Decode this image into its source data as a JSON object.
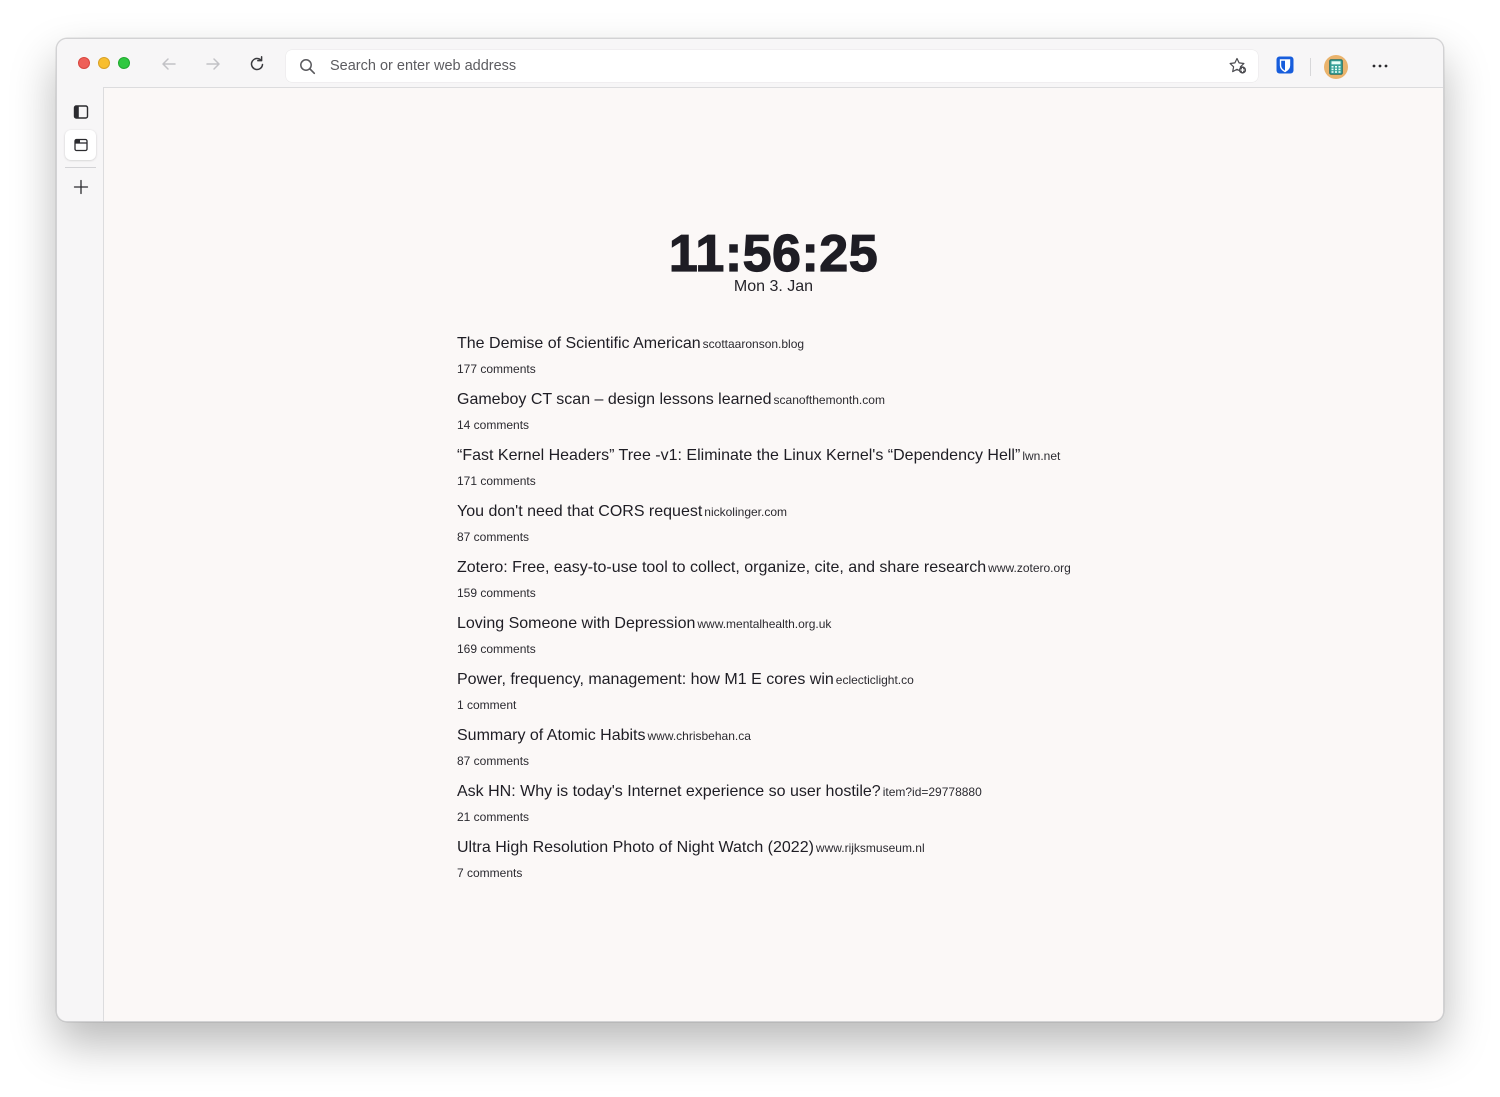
{
  "browser": {
    "address_placeholder": "Search or enter web address",
    "icons": {
      "back": "arrow-left-icon",
      "forward": "arrow-right-icon",
      "reload": "reload-icon",
      "search": "search-icon",
      "favorite": "add-favorite-icon",
      "bitwarden": "bitwarden-icon",
      "calculator": "calculator-icon",
      "menu": "more-horizontal-icon"
    },
    "colors": {
      "close": "#ee5f58",
      "minimize": "#f8be2f",
      "maximize": "#2fc840",
      "bitwarden": "#175ddc",
      "calculator_bg": "#eab36c"
    }
  },
  "sidebar": {
    "items": [
      {
        "name": "sidebar-toggle",
        "icon": "sidebar-icon"
      },
      {
        "name": "tab-current",
        "icon": "tab-icon"
      },
      {
        "name": "new-tab",
        "icon": "plus-icon"
      }
    ]
  },
  "newtab": {
    "time": "11:56:25",
    "date": "Mon 3. Jan",
    "stories": [
      {
        "title": "The Demise of Scientific American",
        "domain": "scottaaronson.blog",
        "comments": "177 comments"
      },
      {
        "title": "Gameboy CT scan – design lessons learned",
        "domain": "scanofthemonth.com",
        "comments": "14 comments"
      },
      {
        "title": "“Fast Kernel Headers” Tree -v1: Eliminate the Linux Kernel's “Dependency Hell”",
        "domain": "lwn.net",
        "comments": "171 comments"
      },
      {
        "title": "You don't need that CORS request",
        "domain": "nickolinger.com",
        "comments": "87 comments"
      },
      {
        "title": "Zotero: Free, easy-to-use tool to collect, organize, cite, and share research",
        "domain": "www.zotero.org",
        "comments": "159 comments"
      },
      {
        "title": "Loving Someone with Depression",
        "domain": "www.mentalhealth.org.uk",
        "comments": "169 comments"
      },
      {
        "title": "Power, frequency, management: how M1 E cores win",
        "domain": "eclecticlight.co",
        "comments": "1 comment"
      },
      {
        "title": "Summary of Atomic Habits",
        "domain": "www.chrisbehan.ca",
        "comments": "87 comments"
      },
      {
        "title": "Ask HN: Why is today's Internet experience so user hostile?",
        "domain": "item?id=29778880",
        "comments": "21 comments"
      },
      {
        "title": "Ultra High Resolution Photo of Night Watch (2022)",
        "domain": "www.rijksmuseum.nl",
        "comments": "7 comments"
      }
    ]
  }
}
